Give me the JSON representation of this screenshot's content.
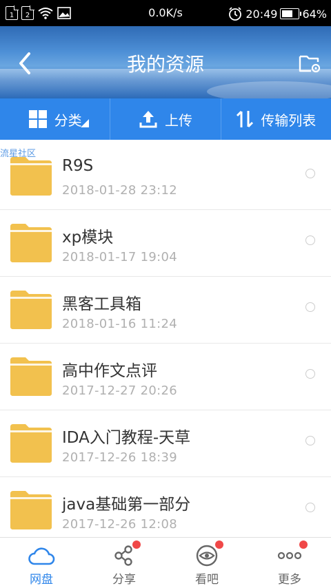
{
  "status_bar": {
    "sim1": "1",
    "sim2": "2",
    "speed": "0.0K/s",
    "time": "20:49",
    "battery": "64%",
    "battery_level": 0.64
  },
  "header": {
    "title": "我的资源"
  },
  "toolbar": {
    "category": "分类",
    "upload": "上传",
    "transfer_list": "传输列表"
  },
  "watermark": "流星社区",
  "files": [
    {
      "name": "R9S",
      "date": "2018-01-28  23:12"
    },
    {
      "name": "xp模块",
      "date": "2018-01-17  19:04"
    },
    {
      "name": "黑客工具箱",
      "date": "2018-01-16  11:24"
    },
    {
      "name": "高中作文点评",
      "date": "2017-12-27  20:26"
    },
    {
      "name": "IDA入门教程-天草",
      "date": "2017-12-26  18:39"
    },
    {
      "name": "java基础第一部分",
      "date": "2017-12-26  12:08"
    }
  ],
  "nav": {
    "cloud": "网盘",
    "share": "分享",
    "watch": "看吧",
    "more": "更多"
  },
  "colors": {
    "accent": "#2f86ea",
    "folder": "#f2c14e",
    "badge": "#f04848"
  }
}
